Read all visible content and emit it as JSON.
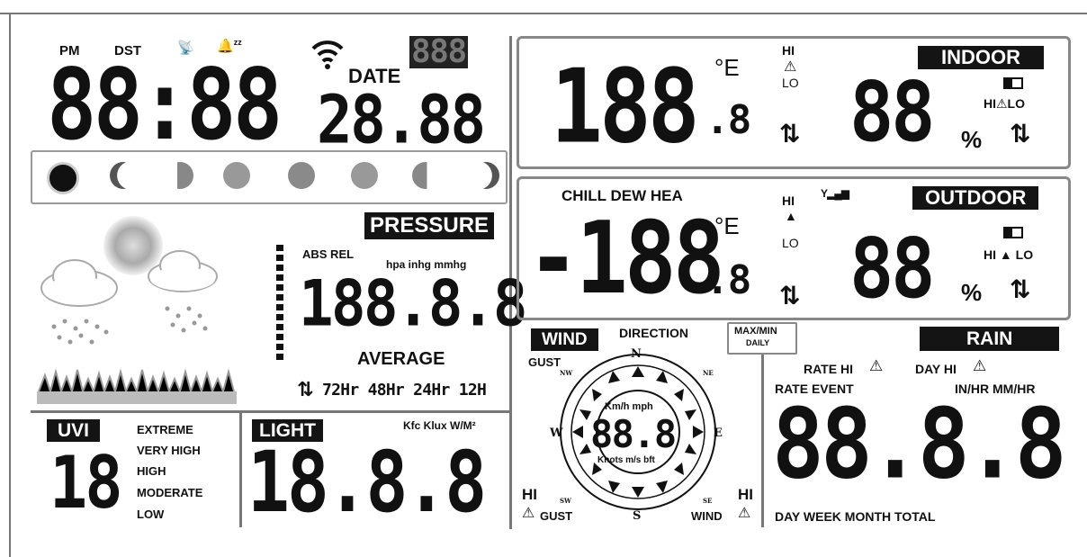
{
  "clock": {
    "pm": "PM",
    "dst": "DST",
    "time": "88:88",
    "date_label": "DATE",
    "date": "28.88",
    "weekday": "888"
  },
  "moon_phases": [
    "new",
    "waxing-crescent",
    "first-quarter",
    "waxing-gibbous",
    "full",
    "waning-gibbous",
    "last-quarter",
    "waning-crescent"
  ],
  "pressure": {
    "title": "PRESSURE",
    "abs_rel": "ABS REL",
    "units": "hpa inhg mmhg",
    "value": "188.8.8",
    "average": "AVERAGE",
    "trend_icon": "up-down-arrow-icon",
    "periods": "72Hr 48Hr 24Hr 12H"
  },
  "indoor": {
    "title": "INDOOR",
    "temp": "188",
    "temp_dec": ".8",
    "temp_unit": "°E",
    "hi": "HI",
    "lo": "LO",
    "humidity": "88",
    "humidity_unit": "%",
    "hi_lo": "HI⚠LO"
  },
  "outdoor": {
    "title": "OUTDOOR",
    "mode": "CHILL DEW HEA",
    "temp": "-188",
    "temp_dec": ".8",
    "temp_unit": "°E",
    "hi": "HI",
    "lo": "LO",
    "humidity": "88",
    "humidity_unit": "%",
    "hi_lo": "HI ▲ LO"
  },
  "wind": {
    "title": "WIND",
    "direction": "DIRECTION",
    "gust_top": "GUST",
    "units_top": "Km/h mph",
    "value": "88.8",
    "units_bottom": "Knots m/s bft",
    "hi_left": "HI",
    "gust_bottom": "GUST",
    "hi_right": "HI",
    "wind_bottom": "WIND",
    "compass": {
      "n": "N",
      "s": "S",
      "e": "E",
      "w": "W",
      "nw": "NW",
      "ne": "NE",
      "sw": "SW",
      "se": "SE"
    }
  },
  "maxmin": {
    "line1": "MAX/MIN",
    "line2": "DAILY"
  },
  "rain": {
    "title": "RAIN",
    "rate_hi": "RATE HI",
    "day_hi": "DAY HI",
    "rate_event": "RATE EVENT",
    "units": "IN/HR MM/HR",
    "value": "88.8.8",
    "periods": "DAY WEEK MONTH TOTAL"
  },
  "uvi": {
    "title": "UVI",
    "value": "18",
    "levels": [
      "EXTREME",
      "VERY HIGH",
      "HIGH",
      "MODERATE",
      "LOW"
    ]
  },
  "light": {
    "title": "LIGHT",
    "units": "Kfc Klux W/M²",
    "value": "18.8.8"
  },
  "icons": {
    "alarm": "radio-tower-icon",
    "snooze": "bell-snooze-icon",
    "wifi": "wifi-icon",
    "battery": "battery-icon",
    "signal": "signal-bars-icon",
    "warning": "warning-triangle-icon"
  }
}
